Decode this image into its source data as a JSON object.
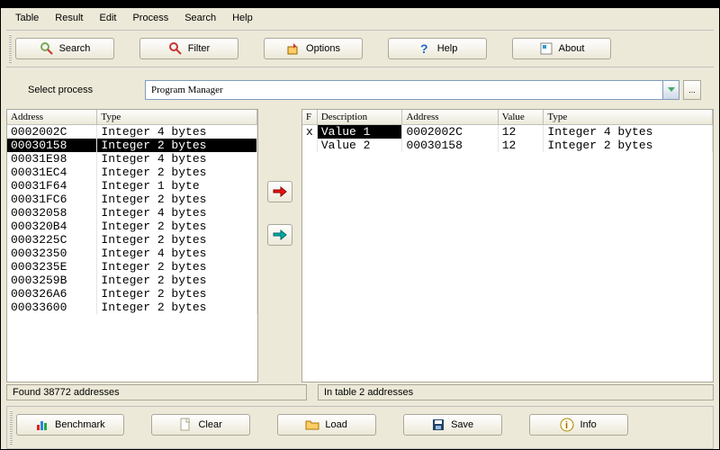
{
  "menu": {
    "items": [
      "Table",
      "Result",
      "Edit",
      "Process",
      "Search",
      "Help"
    ]
  },
  "toolbar": {
    "search": "Search",
    "filter": "Filter",
    "options": "Options",
    "help": "Help",
    "about": "About"
  },
  "process": {
    "label": "Select process",
    "value": "Program Manager",
    "browse": "..."
  },
  "left": {
    "columns": [
      "Address",
      "Type"
    ],
    "rows": [
      {
        "addr": "0002002C",
        "type": "Integer 4 bytes"
      },
      {
        "addr": "00030158",
        "type": "Integer 2 bytes",
        "selected": true
      },
      {
        "addr": "00031E98",
        "type": "Integer 4 bytes"
      },
      {
        "addr": "00031EC4",
        "type": "Integer 2 bytes"
      },
      {
        "addr": "00031F64",
        "type": "Integer 1 byte"
      },
      {
        "addr": "00031FC6",
        "type": "Integer 2 bytes"
      },
      {
        "addr": "00032058",
        "type": "Integer 4 bytes"
      },
      {
        "addr": "000320B4",
        "type": "Integer 2 bytes"
      },
      {
        "addr": "0003225C",
        "type": "Integer 2 bytes"
      },
      {
        "addr": "00032350",
        "type": "Integer 4 bytes"
      },
      {
        "addr": "0003235E",
        "type": "Integer 2 bytes"
      },
      {
        "addr": "0003259B",
        "type": "Integer 2 bytes"
      },
      {
        "addr": "000326A6",
        "type": "Integer 2 bytes"
      },
      {
        "addr": "00033600",
        "type": "Integer 2 bytes"
      }
    ]
  },
  "right": {
    "columns": [
      "F",
      "Description",
      "Address",
      "Value",
      "Type"
    ],
    "rows": [
      {
        "f": "x",
        "desc": "Value 1",
        "addr": "0002002C",
        "val": "12",
        "type": "Integer 4 bytes",
        "first": true
      },
      {
        "f": "",
        "desc": "Value 2",
        "addr": "00030158",
        "val": "12",
        "type": "Integer 2 bytes"
      }
    ]
  },
  "status": {
    "left": "Found 38772 addresses",
    "right": "In table 2 addresses"
  },
  "bottom": {
    "benchmark": "Benchmark",
    "clear": "Clear",
    "load": "Load",
    "save": "Save",
    "info": "Info"
  }
}
